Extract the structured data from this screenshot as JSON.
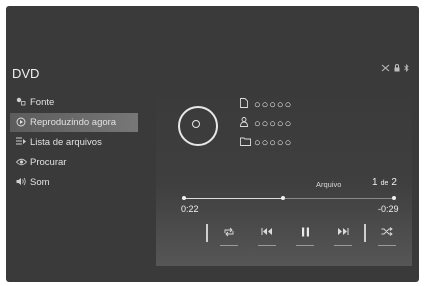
{
  "header": {
    "title": "DVD"
  },
  "status": {
    "icons": [
      "no-signal-icon",
      "lock-icon",
      "bluetooth-icon"
    ]
  },
  "menu": {
    "items": [
      {
        "label": "Fonte",
        "icon": "source-icon",
        "active": false
      },
      {
        "label": "Reproduzindo agora",
        "icon": "play-circle-icon",
        "active": true
      },
      {
        "label": "Lista de arquivos",
        "icon": "list-icon",
        "active": false
      },
      {
        "label": "Procurar",
        "icon": "eye-icon",
        "active": false
      },
      {
        "label": "Som",
        "icon": "speaker-icon",
        "active": false
      }
    ]
  },
  "now_playing": {
    "file_name": "○○○○○",
    "artist": "○○○○○",
    "folder": "○○○○○"
  },
  "track": {
    "label": "Arquivo",
    "current": "1",
    "separator": "de",
    "total": "2"
  },
  "playback": {
    "elapsed": "0:22",
    "remaining": "-0:29",
    "progress_percent": 47
  },
  "controls": [
    "repeat-icon",
    "previous-icon",
    "pause-icon",
    "next-icon",
    "shuffle-icon"
  ],
  "colors": {
    "background": "#3a3a3a",
    "highlight": "#6a6a6a",
    "text": "#e6e6e6"
  }
}
